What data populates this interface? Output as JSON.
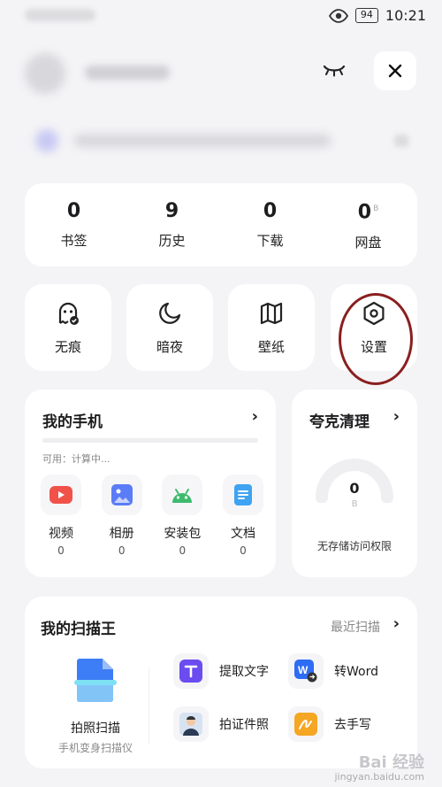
{
  "status": {
    "battery": "94",
    "time": "10:21"
  },
  "stats": [
    {
      "value": "0",
      "unit": "",
      "label": "书签"
    },
    {
      "value": "9",
      "unit": "",
      "label": "历史"
    },
    {
      "value": "0",
      "unit": "",
      "label": "下载"
    },
    {
      "value": "0",
      "unit": "B",
      "label": "网盘"
    }
  ],
  "tiles": [
    {
      "label": "无痕",
      "icon": "ghost-icon"
    },
    {
      "label": "暗夜",
      "icon": "moon-icon"
    },
    {
      "label": "壁纸",
      "icon": "map-icon"
    },
    {
      "label": "设置",
      "icon": "hexagon-settings-icon"
    }
  ],
  "phone": {
    "title": "我的手机",
    "chevron": "›",
    "available": "可用：计算中...",
    "apps": [
      {
        "name": "视频",
        "count": "0",
        "color": "#f0524a"
      },
      {
        "name": "相册",
        "count": "0",
        "color": "#5b7cf7"
      },
      {
        "name": "安装包",
        "count": "0",
        "color": "#3dbb6c"
      },
      {
        "name": "文档",
        "count": "0",
        "color": "#3ea3f2"
      }
    ]
  },
  "clean": {
    "title": "夸克清理",
    "chevron": "›",
    "value": "0",
    "unit": "B",
    "permission": "无存储访问权限"
  },
  "scan": {
    "title": "我的扫描王",
    "recent": "最近扫描",
    "chevron": "›",
    "main_name": "拍照扫描",
    "main_sub": "手机变身扫描仪",
    "tools": [
      {
        "name": "提取文字",
        "icon": "text-extract-icon",
        "color": "#6a4cf0"
      },
      {
        "name": "转Word",
        "icon": "word-icon",
        "color": "#2e6cf5"
      },
      {
        "name": "拍证件照",
        "icon": "id-photo-icon",
        "color": "#d8e3f2"
      },
      {
        "name": "去手写",
        "icon": "remove-handwriting-icon",
        "color": "#f5a623"
      }
    ]
  },
  "watermark": {
    "brand": "Bai 经验",
    "url": "jingyan.baidu.com"
  }
}
